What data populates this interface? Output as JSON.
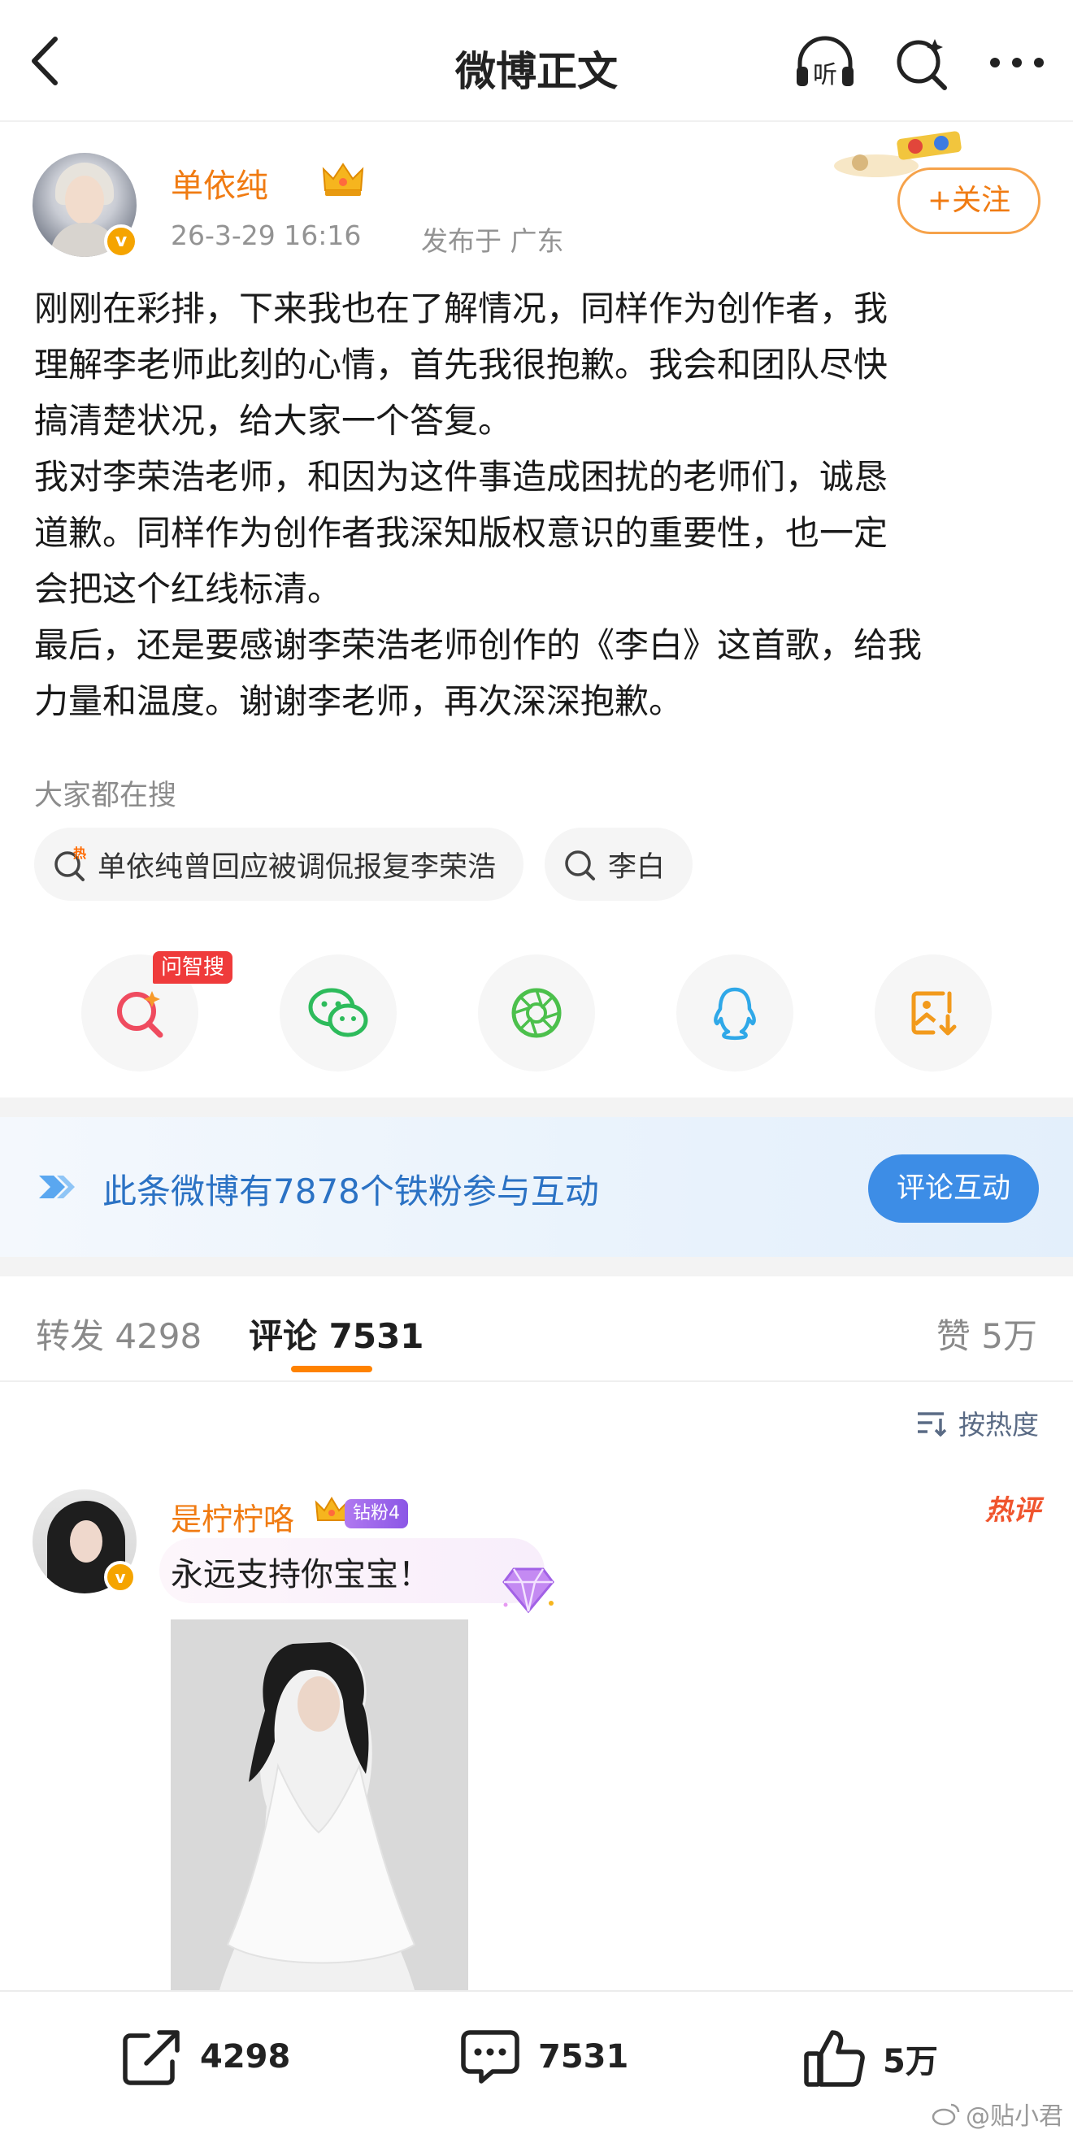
{
  "nav": {
    "title": "微博正文",
    "listen_label": "听"
  },
  "author": {
    "name": "单依纯",
    "verified_mark": "v",
    "time": "26-3-29 16:16",
    "location": "发布于 广东",
    "follow_label": "+关注"
  },
  "post": {
    "lines": [
      "刚刚在彩排，下来我也在了解情况，同样作为创作者，我",
      "理解李老师此刻的心情，首先我很抱歉。我会和团队尽快",
      "搞清楚状况，给大家一个答复。",
      "我对李荣浩老师，和因为这件事造成困扰的老师们，诚恳",
      "道歉。同样作为创作者我深知版权意识的重要性，也一定",
      "会把这个红线标清。",
      "最后，还是要感谢李荣浩老师创作的《李白》这首歌，给我",
      "力量和温度。谢谢李老师，再次深深抱歉。"
    ]
  },
  "search": {
    "label": "大家都在搜",
    "chips": [
      {
        "text": "单依纯曾回应被调侃报复李荣浩",
        "icon": "hot-search-icon",
        "hot_mark": "热"
      },
      {
        "text": "李白",
        "icon": "search-icon"
      }
    ]
  },
  "share": {
    "ai_tag": "问智搜",
    "buttons": [
      "ai-search-icon",
      "wechat-icon",
      "moments-icon",
      "qq-icon",
      "save-image-icon"
    ]
  },
  "fans_banner": {
    "text": "此条微博有7878个铁粉参与互动",
    "button": "评论互动"
  },
  "tabs": {
    "repost": "转发 4298",
    "comments": "评论 7531",
    "likes": "赞 5万"
  },
  "sort_label": "按热度",
  "comment": {
    "name": "是柠柠咯",
    "verified_mark": "v",
    "fan_badge": "钻粉4",
    "hot_badge": "热评",
    "text": "永远支持你宝宝！"
  },
  "bottom_bar": {
    "repost_count": "4298",
    "comment_count": "7531",
    "like_count": "5万"
  },
  "watermark": "@贴小君",
  "colors": {
    "brand_orange": "#f07b12",
    "link_blue": "#2b72c4",
    "button_blue": "#3d8de6",
    "hot_red": "#f0552e",
    "tab_underline": "#ff8200"
  }
}
